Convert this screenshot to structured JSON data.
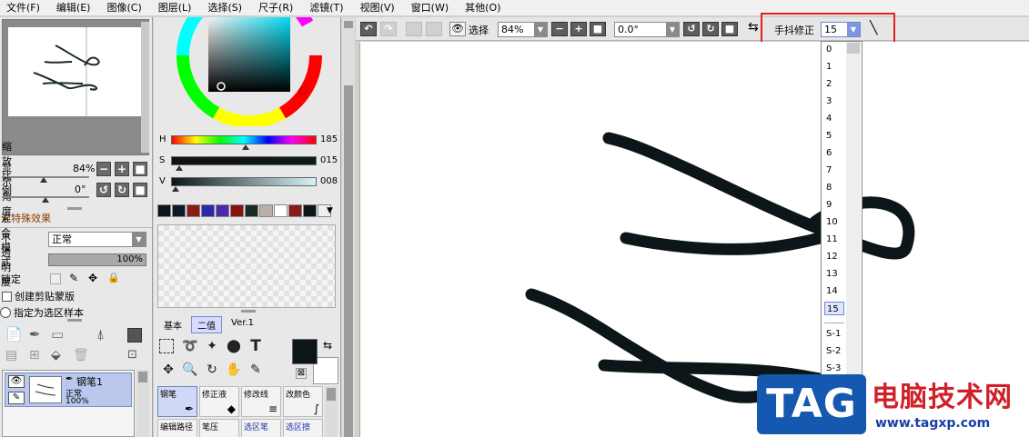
{
  "menu": [
    "文件(F)",
    "编辑(E)",
    "图像(C)",
    "图层(L)",
    "选择(S)",
    "尺子(R)",
    "滤镜(T)",
    "视图(V)",
    "窗口(W)",
    "其他(O)"
  ],
  "navigator": {
    "zoom_label": "缩放比例",
    "zoom_value": "84%",
    "angle_label": "显示角度",
    "angle_value": "0°"
  },
  "layer_panel": {
    "effects_title": "特殊效果",
    "blend_label": "混合模式",
    "blend_value": "正常",
    "opacity_label": "不透明度",
    "opacity_value": "100%",
    "lock_label": "锁定",
    "clip_label": "创建剪贴蒙版",
    "sample_label": "指定为选区样本",
    "layer": {
      "name": "钢笔1",
      "mode": "正常",
      "opacity": "100%"
    }
  },
  "color": {
    "h_label": "H",
    "h_value": "185",
    "s_label": "S",
    "s_value": "015",
    "v_label": "V",
    "v_value": "008",
    "h_fraction": 0.514,
    "s_fraction": 0.059,
    "v_fraction": 0.031,
    "swatches": [
      "#0c1618",
      "#0a1a2a",
      "#8b1a1a",
      "#2a2aa8",
      "#4a2ab0",
      "#8a1010",
      "#1a2a28",
      "#b8b0a8",
      "#ffffff",
      "#8a1a1a",
      "#0c1618",
      "#f0f0f0"
    ],
    "main_color": "#0c1618"
  },
  "tool_tabs": [
    "基本",
    "二值",
    "Ver.1"
  ],
  "brushes": [
    "钢笔",
    "修正液",
    "修改线",
    "改颜色",
    "编辑路径",
    "笔压",
    "选区笔",
    "选区擦"
  ],
  "toolbar": {
    "select_label": "选择",
    "zoom": "84%",
    "angle": "0.0°",
    "stabilizer_label": "手抖修正",
    "stabilizer_value": "15"
  },
  "stabilizer_options": [
    "0",
    "1",
    "2",
    "3",
    "4",
    "5",
    "6",
    "7",
    "8",
    "9",
    "10",
    "11",
    "12",
    "13",
    "14",
    "15",
    "S-1",
    "S-2",
    "S-3"
  ],
  "stabilizer_selected": "15",
  "watermark": {
    "tag": "TAG",
    "site_name": "电脑技术网",
    "url": "www.tagxp.com"
  }
}
